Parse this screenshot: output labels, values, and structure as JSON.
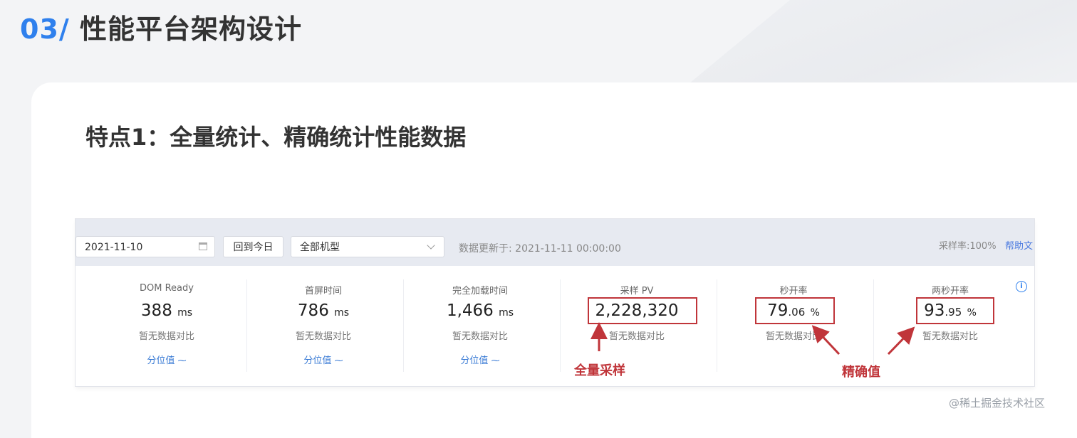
{
  "slide": {
    "num": "03/",
    "title": "性能平台架构设计"
  },
  "feature_title": "特点1：全量统计、精确统计性能数据",
  "toolbar": {
    "date": "2021-11-10",
    "today_button": "回到今日",
    "model_select": "全部机型",
    "update_text": "数据更新于: 2021-11-11 00:00:00",
    "rate": "采样率:100%",
    "help": "帮助文"
  },
  "metrics": [
    {
      "label": "DOM Ready",
      "value": "388",
      "unit": "ms",
      "compare": "暂无数据对比",
      "pct": "分位值"
    },
    {
      "label": "首屏时间",
      "value": "786",
      "unit": "ms",
      "compare": "暂无数据对比",
      "pct": "分位值"
    },
    {
      "label": "完全加载时间",
      "value": "1,466",
      "unit": "ms",
      "compare": "暂无数据对比",
      "pct": "分位值"
    },
    {
      "label": "采样 PV",
      "value": "2,228,320",
      "compare": "暂无数据对比"
    },
    {
      "label": "秒开率",
      "value": "79",
      "decimal": ".06",
      "unit": "%",
      "compare": "暂无数据对比"
    },
    {
      "label": "两秒开率",
      "value": "93",
      "decimal": ".95",
      "unit": "%",
      "compare": "暂无数据对比"
    }
  ],
  "annotations": {
    "full_sampling": "全量采样",
    "precise_value": "精确值"
  },
  "accent_color": "#c0353a",
  "link_color": "#3a7bd5",
  "watermark": "@稀土掘金技术社区"
}
